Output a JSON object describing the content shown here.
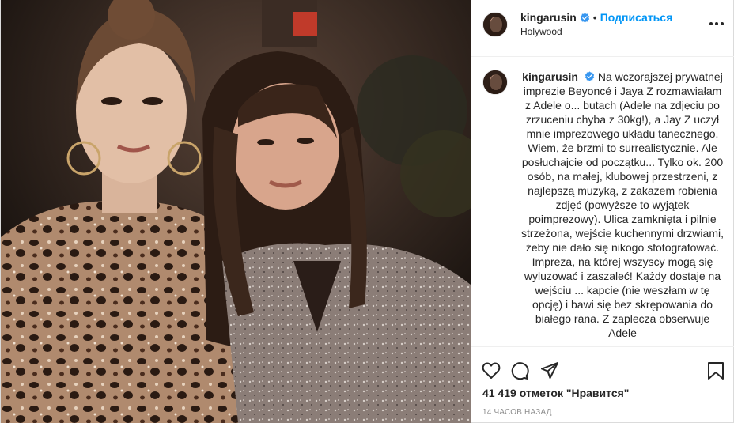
{
  "post": {
    "username": "kingarusin",
    "follow_label": "Подписаться",
    "separator": "•",
    "location": "Holywood",
    "caption_user": "kingarusin",
    "caption_text": "Na wczorajszej prywatnej imprezie Beyoncé i Jaya Z rozmawiałam z Adele o... butach (Adele na zdjęciu po zrzuceniu chyba z 30kg!), a Jay Z uczył mnie imprezowego układu tanecznego. Wiem, że brzmi to surrealistycznie. Ale posłuchajcie od początku... Tylko ok. 200 osób, na małej,  klubowej przestrzeni, z najlepszą muzyką, z zakazem robienia zdjęć (powyższe to wyjątek poimprezowy). Ulica zamknięta i pilnie strzeżona, wejście kuchennymi drzwiami, żeby nie dało się nikogo sfotografować. Impreza, na której wszyscy mogą się wyluzować i zaszaleć! Każdy dostaje na wejściu ... kapcie (nie weszłam w tę opcję) i bawi się bez skrępowania do białego rana. Z zaplecza obserwuje Adele",
    "likes_text": "41 419 отметок \"Нравится\"",
    "time_text": "14 ЧАСОВ НАЗАД"
  },
  "icons": {
    "header": [
      "avatar",
      "verified-icon",
      "more-icon"
    ],
    "actions": [
      "heart-icon",
      "comment-icon",
      "share-icon",
      "bookmark-icon"
    ]
  },
  "colors": {
    "accent": "#0095f6",
    "verified": "#3897f0",
    "text": "#262626",
    "muted": "#8e8e8e",
    "divider": "#efefef"
  }
}
